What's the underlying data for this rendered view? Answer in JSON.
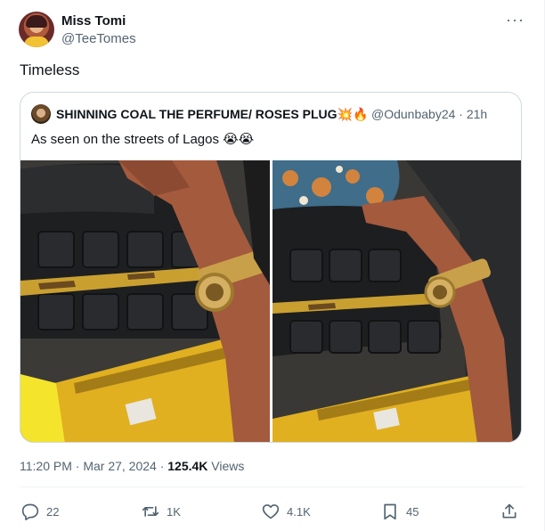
{
  "author": {
    "display_name": "Miss Tomi",
    "handle": "@TeeTomes",
    "more_label": "···"
  },
  "tweet": {
    "text": "Timeless"
  },
  "quoted": {
    "display_name": "SHINNING COAL THE PERFUME/ ROSES PLUG💥🔥",
    "handle_time": "@Odunbaby24 · 21h",
    "text": "As seen on the streets of Lagos 😭😭"
  },
  "meta": {
    "time_date": "11:20 PM · Mar 27, 2024 · ",
    "views_count": "125.4K",
    "views_label": " Views"
  },
  "actions": {
    "replies": "22",
    "reposts": "1K",
    "likes": "4.1K",
    "bookmarks": "45"
  },
  "icons": {
    "reply": "reply-icon",
    "repost": "repost-icon",
    "like": "heart-icon",
    "bookmark": "bookmark-icon",
    "share": "share-icon"
  },
  "colors": {
    "text": "#0f1419",
    "secondary": "#536471",
    "border": "#cfd9de"
  }
}
